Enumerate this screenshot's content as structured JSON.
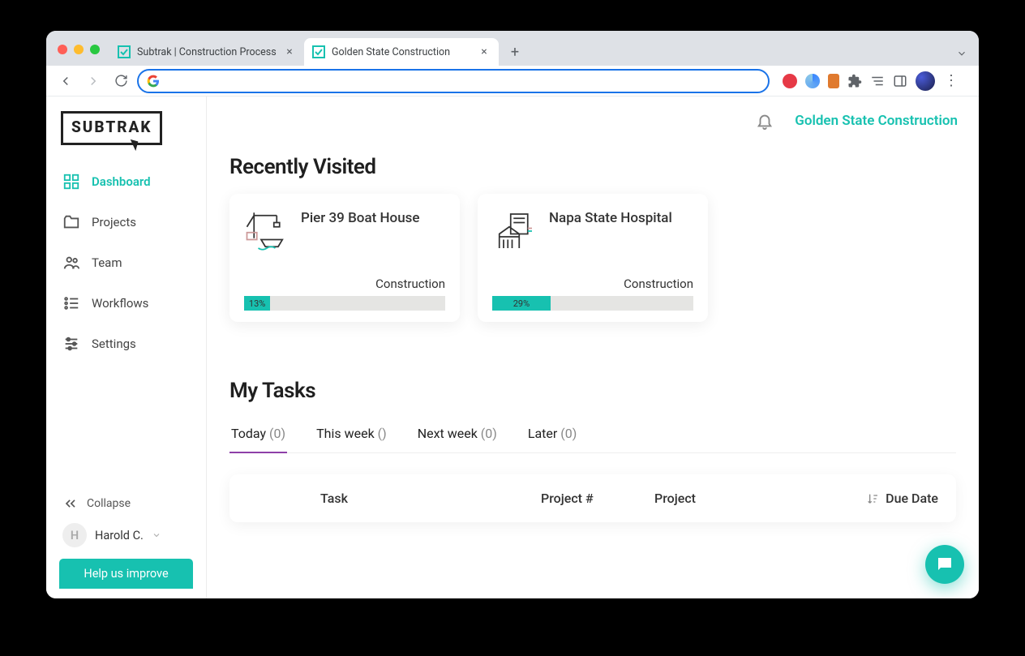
{
  "browser": {
    "tabs": [
      {
        "title": "Subtrak | Construction Process",
        "active": false
      },
      {
        "title": "Golden State Construction",
        "active": true
      }
    ]
  },
  "app": {
    "logo_text": "SUBTRAK",
    "company_name": "Golden State Construction",
    "sidebar": {
      "items": [
        {
          "label": "Dashboard",
          "icon": "dashboard-icon",
          "active": true
        },
        {
          "label": "Projects",
          "icon": "folder-icon",
          "active": false
        },
        {
          "label": "Team",
          "icon": "team-icon",
          "active": false
        },
        {
          "label": "Workflows",
          "icon": "list-icon",
          "active": false
        },
        {
          "label": "Settings",
          "icon": "sliders-icon",
          "active": false
        }
      ],
      "collapse_label": "Collapse",
      "user_name": "Harold C.",
      "user_initial": "H",
      "help_button": "Help us improve"
    },
    "recently_visited": {
      "heading": "Recently Visited",
      "projects": [
        {
          "title": "Pier 39 Boat House",
          "status": "Construction",
          "progress_pct": 13,
          "progress_label": "13%",
          "icon": "crane-boat-icon"
        },
        {
          "title": "Napa State Hospital",
          "status": "Construction",
          "progress_pct": 29,
          "progress_label": "29%",
          "icon": "building-icon"
        }
      ]
    },
    "my_tasks": {
      "heading": "My Tasks",
      "tabs": [
        {
          "label": "Today",
          "count_label": "(0)",
          "active": true
        },
        {
          "label": "This week",
          "count_label": "()",
          "active": false
        },
        {
          "label": "Next week",
          "count_label": "(0)",
          "active": false
        },
        {
          "label": "Later",
          "count_label": "(0)",
          "active": false
        }
      ],
      "columns": {
        "task": "Task",
        "project_num": "Project #",
        "project": "Project",
        "due_date": "Due Date"
      }
    }
  }
}
